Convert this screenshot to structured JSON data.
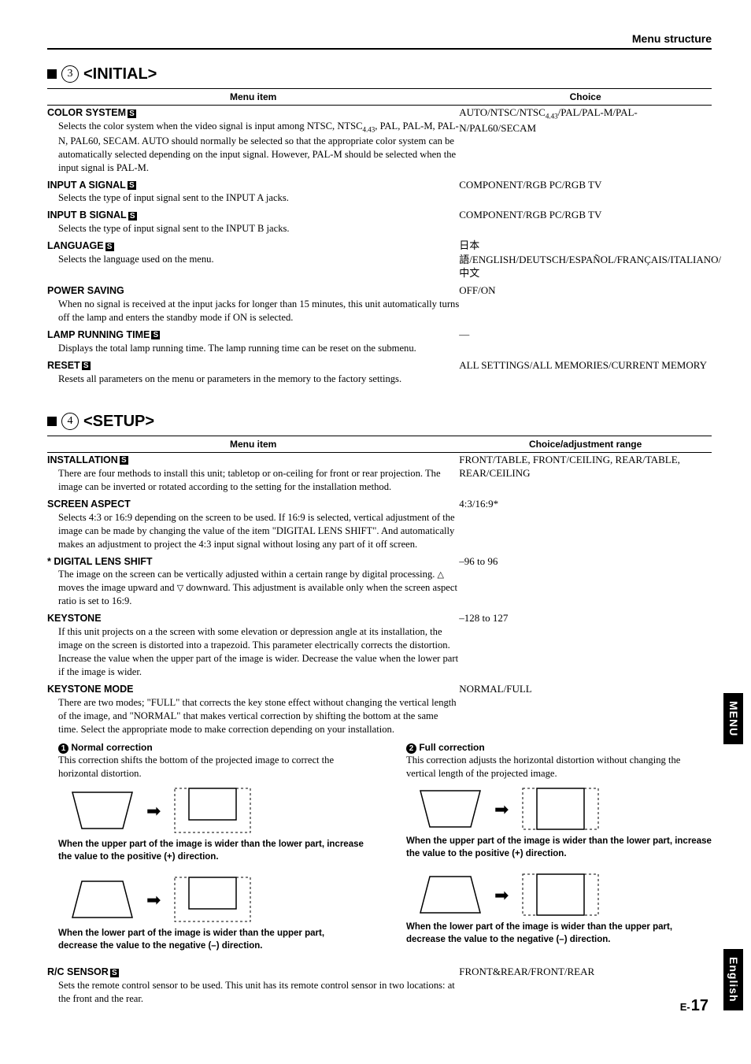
{
  "header": {
    "title": "Menu structure"
  },
  "section3": {
    "num": "3",
    "title": "<INITIAL>",
    "col_left": "Menu item",
    "col_right": "Choice",
    "items": [
      {
        "name": "COLOR SYSTEM",
        "s": true,
        "desc_html": "Selects the color system when the video signal is input among NTSC, NTSC<sub>4.43</sub>, PAL, PAL-M, PAL-N, PAL60, SECAM. AUTO should normally be selected so that the appropriate color system can be automatically selected depending on the input signal. However, PAL-M should be selected when the input signal is PAL-M.",
        "choice_html": "AUTO/NTSC/NTSC<sub>4.43</sub>/PAL/PAL-M/PAL-N/PAL60/SECAM"
      },
      {
        "name": "INPUT A SIGNAL",
        "s": true,
        "desc": "Selects the type of input signal sent to the INPUT A jacks.",
        "choice": "COMPONENT/RGB PC/RGB TV"
      },
      {
        "name": "INPUT B SIGNAL",
        "s": true,
        "desc": "Selects the type of input signal sent to the INPUT B jacks.",
        "choice": "COMPONENT/RGB PC/RGB TV"
      },
      {
        "name": "LANGUAGE",
        "s": true,
        "desc": "Selects the language used on the menu.",
        "choice": "日本語/ENGLISH/DEUTSCH/ESPAÑOL/FRANÇAIS/ITALIANO/中文"
      },
      {
        "name": "POWER SAVING",
        "s": false,
        "desc": "When no signal is received at the input jacks for longer than 15 minutes, this unit automatically turns off the lamp and enters the standby mode if ON is selected.",
        "choice": "OFF/ON"
      },
      {
        "name": "LAMP RUNNING TIME",
        "s": true,
        "desc": "Displays the total lamp running time. The lamp running time can be reset on the submenu.",
        "choice": "—"
      },
      {
        "name": "RESET",
        "s": true,
        "desc": "Resets all parameters on the menu or parameters in the memory to the factory settings.",
        "choice": "ALL SETTINGS/ALL MEMORIES/CURRENT MEMORY"
      }
    ]
  },
  "section4": {
    "num": "4",
    "title": "<SETUP>",
    "col_left": "Menu item",
    "col_right": "Choice/adjustment range",
    "items": [
      {
        "name": "INSTALLATION",
        "s": true,
        "desc": "There are four methods to install this unit; tabletop or on-ceiling for front or rear projection. The image can be inverted or rotated according to the setting for the installation method.",
        "choice": "FRONT/TABLE, FRONT/CEILING, REAR/TABLE, REAR/CEILING"
      },
      {
        "name": "SCREEN ASPECT",
        "s": false,
        "desc": "Selects 4:3 or 16:9 depending on the screen to be used. If 16:9 is selected, vertical adjustment of the image can be made by changing the value of the item \"DIGITAL LENS SHIFT\". And automatically makes an adjustment to project the 4:3 input signal without losing any part of it off screen.",
        "choice": "4:3/16:9*"
      },
      {
        "name": "* DIGITAL LENS SHIFT",
        "s": false,
        "desc_html": "The image on the screen can be vertically adjusted within a certain range by digital processing. <span class='tri'>△</span> moves the image upward and <span class='tri'>▽</span> downward. This adjustment is available only when the screen aspect ratio is set to 16:9.",
        "choice": "–96 to 96"
      },
      {
        "name": "KEYSTONE",
        "s": false,
        "desc": "If this unit projects on a the screen with some elevation or depression angle at its installation, the image on the screen is distorted into a trapezoid. This parameter electrically corrects the distortion. Increase the value when the upper part of the image is wider. Decrease the value when the lower part if the image is wider.",
        "choice": "–128 to 127"
      },
      {
        "name": "KEYSTONE MODE",
        "s": false,
        "desc": "There are two modes; \"FULL\" that corrects the key stone effect without changing the vertical length of the image, and \"NORMAL\" that makes vertical correction by shifting the bottom at the same time. Select the appropriate mode to make correction depending on your installation.",
        "choice": "NORMAL/FULL"
      }
    ],
    "keystone_examples": {
      "normal": {
        "num": "1",
        "title": "Normal correction",
        "desc": "This correction shifts the bottom of the projected image to correct the horizontal distortion.",
        "cap_upper": "When the upper part of the image is wider than the lower part, increase the value to the positive (+) direction.",
        "cap_lower": "When the lower part of the image is wider than the upper part, decrease the value to the negative (–) direction."
      },
      "full": {
        "num": "2",
        "title": "Full correction",
        "desc": "This correction adjusts the horizontal distortion without changing the vertical length of the projected image.",
        "cap_upper": "When the upper part of the image is wider than the lower part, increase the value to the positive (+) direction.",
        "cap_lower": "When the lower part of the image is wider than the upper part, decrease the value to the negative (–) direction."
      }
    },
    "rc_sensor": {
      "name": "R/C SENSOR",
      "s": true,
      "desc": "Sets the remote control sensor to be used. This unit has its remote control sensor in two locations: at the front and the rear.",
      "choice": "FRONT&REAR/FRONT/REAR"
    }
  },
  "side": {
    "tab1": "MENU",
    "tab2": "English"
  },
  "page": {
    "prefix": "E-",
    "num": "17"
  }
}
